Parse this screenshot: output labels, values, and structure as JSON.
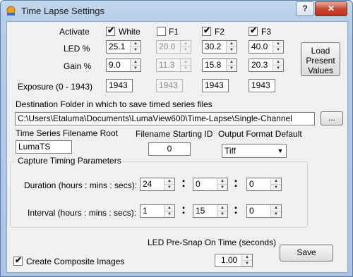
{
  "window": {
    "title": "Time Lapse Settings",
    "help_label": "?",
    "close_label": "✕"
  },
  "activate": {
    "label": "Activate",
    "channels": [
      {
        "name": "White",
        "checked": true
      },
      {
        "name": "F1",
        "checked": false
      },
      {
        "name": "F2",
        "checked": true
      },
      {
        "name": "F3",
        "checked": true
      }
    ]
  },
  "led": {
    "label": "LED %",
    "values": [
      "25.1",
      "20.0",
      "30.2",
      "40.0"
    ]
  },
  "gain": {
    "label": "Gain %",
    "values": [
      "9.0",
      "11.3",
      "15.8",
      "20.3"
    ]
  },
  "exposure": {
    "label": "Exposure (0 - 1943)",
    "values": [
      "1943",
      "1943",
      "1943",
      "1943"
    ]
  },
  "load_button": "Load\nPresent\nValues",
  "destination": {
    "label": "Destination Folder in which to save timed series files",
    "path": "C:\\Users\\Etaluma\\Documents\\LumaView600\\Time-Lapse\\Single-Channel",
    "browse_label": "..."
  },
  "filename_root": {
    "label": "Time Series Filename Root",
    "value": "LumaTS"
  },
  "filename_start": {
    "label": "Filename Starting ID",
    "value": "0"
  },
  "output_format": {
    "label": "Output Format Default",
    "value": "Tiff"
  },
  "capture_timing": {
    "title": "Capture Timing Parameters",
    "duration_label": "Duration (hours : mins : secs):",
    "duration": [
      "24",
      "0",
      "0"
    ],
    "interval_label": "Interval (hours : mins : secs):",
    "interval": [
      "1",
      "15",
      "0"
    ],
    "colon": ":"
  },
  "prescan": {
    "label": "LED Pre-Snap On Time (seconds)",
    "value": "1.00"
  },
  "composite": {
    "label": "Create Composite Images",
    "checked": true
  },
  "save_label": "Save",
  "check_mark": "✔",
  "arrow_up": "▲",
  "arrow_down": "▼"
}
